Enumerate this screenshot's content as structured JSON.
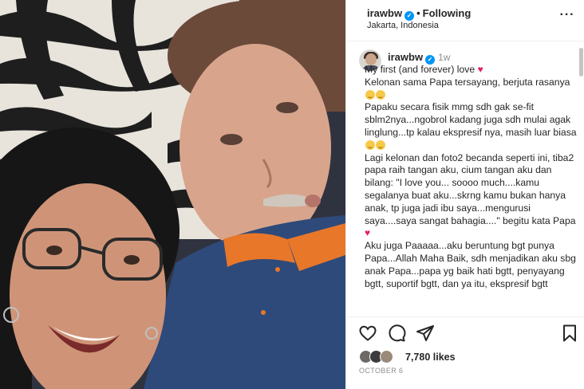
{
  "header": {
    "username": "irawbw",
    "verified_mark": "✓",
    "separator": "•",
    "follow_state": "Following",
    "location": "Jakarta, Indonesia",
    "more_label": "···"
  },
  "caption": {
    "username": "irawbw",
    "time": "1w",
    "lines": [
      "My first (and forever) love",
      "Kelonan sama Papa tersayang, berjuta rasanya",
      "Papaku secara fisik mmg sdh gak se-fit sblm2nya...ngobrol kadang juga sdh mulai agak linglung...tp kalau ekspresif nya, masih luar biasa",
      "Lagi kelonan dan foto2 becanda seperti ini, tiba2 papa raih tangan aku, cium tangan aku dan bilang: \"I love you... soooo much....kamu segalanya buat aku...skrng kamu bukan hanya anak, tp juga jadi ibu saya...mengurusi saya....saya sangat bahagia....\" begitu kata Papa",
      "Aku juga Paaaaa...aku beruntung bgt punya Papa...Allah Maha Baik, sdh menjadikan aku sbg anak Papa...papa yg baik hati bgtt, penyayang bgtt, suportif bgtt, dan ya itu, ekspresif bgtt"
    ],
    "heart_glyph": "♥"
  },
  "actions": {
    "like_icon": "heart-outline-icon",
    "comment_icon": "comment-icon",
    "share_icon": "send-icon",
    "save_icon": "bookmark-icon"
  },
  "likes": {
    "count_label": "7,780 likes"
  },
  "date": "OCTOBER 6",
  "colors": {
    "verified": "#0095f6",
    "heart": "#e0245e",
    "muted": "#8e8e8e",
    "text": "#262626"
  }
}
